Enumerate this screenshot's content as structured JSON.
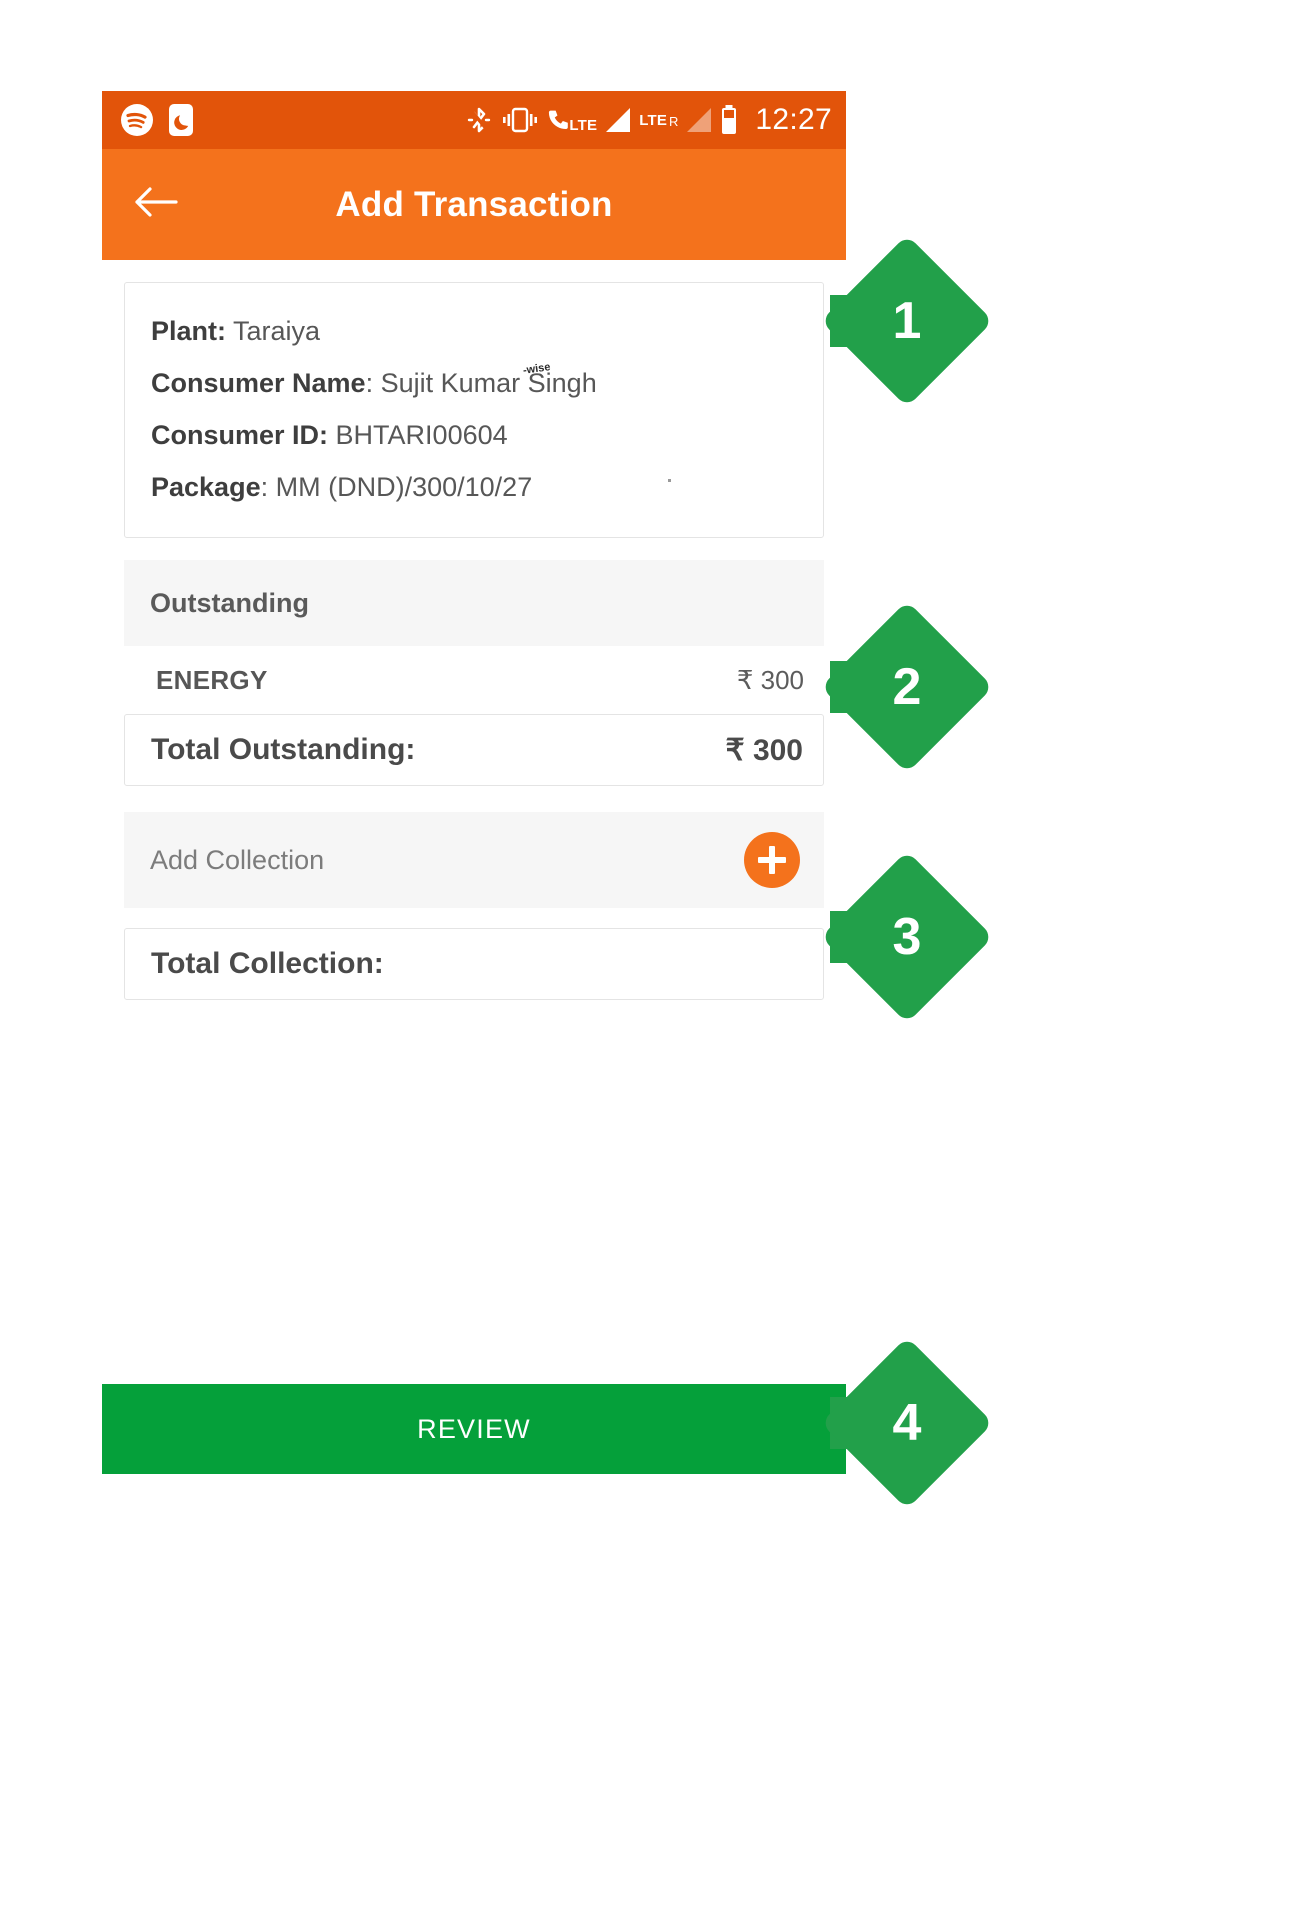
{
  "statusbar": {
    "time": "12:27",
    "left_icons": [
      {
        "name": "spotify-icon",
        "label": "Spotify"
      },
      {
        "name": "do-not-disturb-moon-icon",
        "label": "Do Not Disturb"
      }
    ],
    "right_icons": [
      {
        "name": "bluetooth-off-icon",
        "label": "Bluetooth disabled"
      },
      {
        "name": "vibrate-icon",
        "label": "Vibrate"
      },
      {
        "name": "call-lte-icon",
        "label": "LTE call"
      },
      {
        "name": "signal-bar-icon-1",
        "label": "Signal SIM 1"
      },
      {
        "name": "lte-roaming-icon",
        "label": "LTE R"
      },
      {
        "name": "signal-bar-icon-2",
        "label": "Signal SIM 2"
      },
      {
        "name": "battery-icon",
        "label": "Battery"
      }
    ],
    "lte_label": "LTE",
    "lte_roaming_label": "LTE",
    "roaming_suffix": "R"
  },
  "appbar": {
    "title": "Add Transaction",
    "back_icon": "back-arrow-icon"
  },
  "info_card": {
    "rows": [
      {
        "label": "Plant:",
        "value": "Taraiya"
      },
      {
        "label": "Consumer Name",
        "separator": ":",
        "value": "Sujit Kumar Singh"
      },
      {
        "label": "Consumer ID:",
        "value": "BHTARI00604"
      },
      {
        "label": "Package",
        "separator": ":",
        "value": "MM (DND)/300/10/27"
      }
    ],
    "watermark": "-wise"
  },
  "outstanding": {
    "section_title": "Outstanding",
    "lines": [
      {
        "label": "ENERGY",
        "amount": "₹ 300"
      }
    ],
    "total_label": "Total Outstanding:",
    "total_amount": "₹ 300"
  },
  "collection": {
    "band_title": "Add Collection",
    "add_icon": "plus-icon",
    "total_label": "Total Collection:",
    "total_amount": ""
  },
  "footer": {
    "review_label": "REVIEW"
  },
  "callouts": [
    {
      "number": "1"
    },
    {
      "number": "2"
    },
    {
      "number": "3"
    },
    {
      "number": "4"
    }
  ],
  "colors": {
    "statusbar": "#E2540A",
    "appbar": "#F4721C",
    "accent": "#F4721C",
    "review_green": "#05A03A",
    "callout_green": "#22A04A",
    "band_gray": "#F6F6F6"
  }
}
